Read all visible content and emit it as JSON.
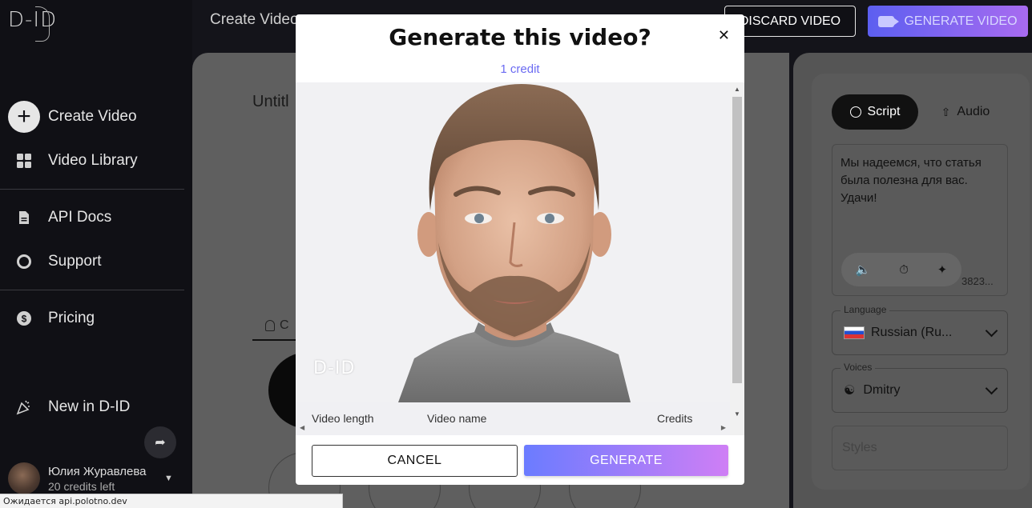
{
  "app": {
    "logo": "D-ID",
    "page_title": "Create Video"
  },
  "sidebar": {
    "items": [
      {
        "label": "Create Video",
        "icon": "plus-icon"
      },
      {
        "label": "Video Library",
        "icon": "grid-icon"
      },
      {
        "label": "API Docs",
        "icon": "document-icon"
      },
      {
        "label": "Support",
        "icon": "lifebuoy-icon"
      },
      {
        "label": "Pricing",
        "icon": "dollar-icon"
      },
      {
        "label": "New in D-ID",
        "icon": "party-icon"
      }
    ],
    "user": {
      "name": "Юлия Журавлева",
      "credits": "20 credits left"
    }
  },
  "toolbar": {
    "discard_label": "DISCARD VIDEO",
    "generate_label": "GENERATE VIDEO"
  },
  "editor": {
    "title": "Untitl",
    "presenter_tab": "C"
  },
  "right_panel": {
    "tab_script": "Script",
    "tab_audio": "Audio",
    "script_text": "Мы надеемся, что статья была полезна для вас. Удачи!",
    "char_count": "3823...",
    "language_label": "Language",
    "language_value": "Russian (Ru...",
    "voices_label": "Voices",
    "voice_value": "Dmitry",
    "styles_placeholder": "Styles"
  },
  "modal": {
    "title": "Generate this video?",
    "credit": "1 credit",
    "watermark": "D-ID",
    "info_headers": [
      "Video length",
      "Video name",
      "Credits"
    ],
    "cancel_label": "CANCEL",
    "generate_label": "GENERATE"
  },
  "status_bar": {
    "text": "Ожидается api.polotno.dev"
  },
  "colors": {
    "accent": "#6b6bf2",
    "gradient_start": "#6b7cff",
    "gradient_end": "#cf7ef5",
    "sidebar_bg": "#101015"
  }
}
